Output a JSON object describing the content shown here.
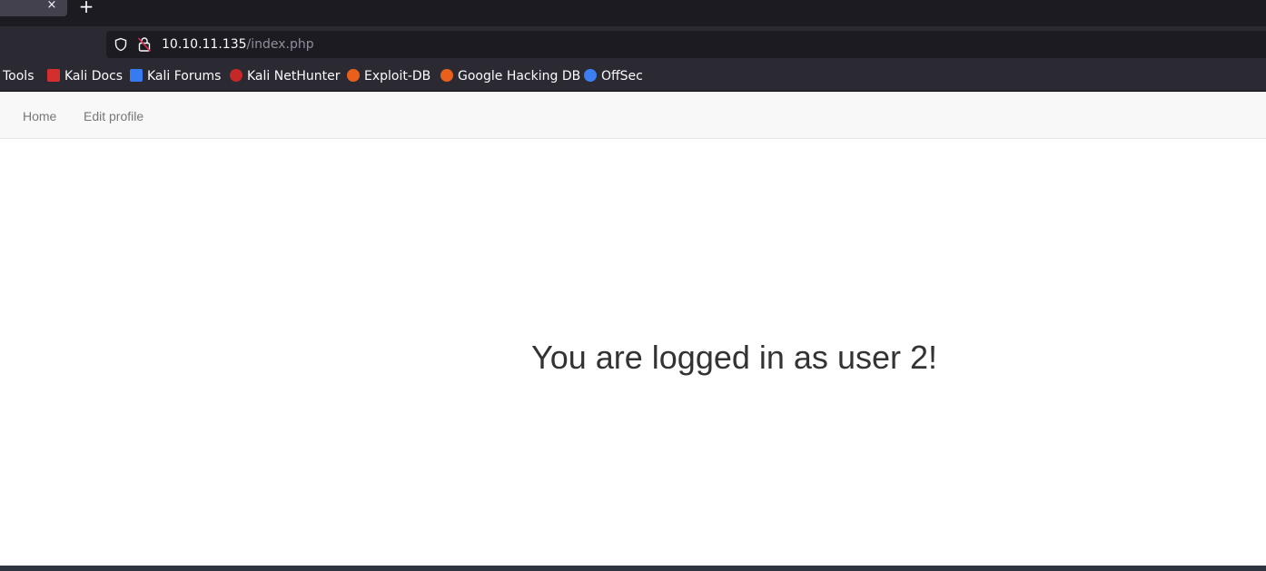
{
  "browser": {
    "tab_close_glyph": "×",
    "new_tab_glyph": "+",
    "url": {
      "host": "10.10.11.135",
      "path": "/index.php"
    },
    "bookmarks": [
      {
        "label": "Tools",
        "icon": "none"
      },
      {
        "label": "Kali Docs",
        "icon": "kali-docs-icon",
        "color": "#d32f2f"
      },
      {
        "label": "Kali Forums",
        "icon": "kali-forums-icon",
        "color": "#367bf0"
      },
      {
        "label": "Kali NetHunter",
        "icon": "kali-nethunter-icon",
        "color": "#c62828"
      },
      {
        "label": "Exploit-DB",
        "icon": "exploit-db-icon",
        "color": "#e8601c"
      },
      {
        "label": "Google Hacking DB",
        "icon": "ghdb-icon",
        "color": "#e8601c"
      },
      {
        "label": "OffSec",
        "icon": "offsec-icon",
        "color": "#3d7ff2"
      }
    ]
  },
  "site": {
    "nav": {
      "home": "Home",
      "edit_profile": "Edit profile"
    },
    "message": "You are logged in as user 2!"
  }
}
